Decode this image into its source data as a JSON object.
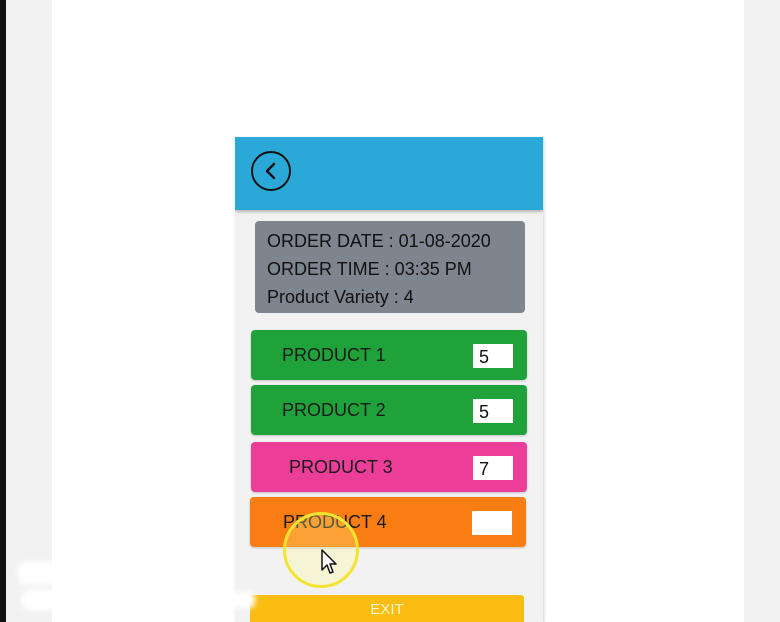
{
  "header": {
    "back_icon": "chevron-left-icon",
    "background": "#2aa9d9"
  },
  "order_info": {
    "date_line": "ORDER DATE : 01-08-2020",
    "time_line": "ORDER TIME : 03:35 PM",
    "variety_line": "Product Variety :   4"
  },
  "products": [
    {
      "label": "PRODUCT 1",
      "qty": "5",
      "color": "#1fa23a"
    },
    {
      "label": "PRODUCT 2",
      "qty": "5",
      "color": "#1fa23a"
    },
    {
      "label": "PRODUCT 3",
      "qty": "7",
      "color": "#ec3d98"
    },
    {
      "label": "PRODUCT 4",
      "qty": "",
      "color": "#fa7d14"
    }
  ],
  "exit_label": "EXIT",
  "accent_exit": "#fbbd12"
}
